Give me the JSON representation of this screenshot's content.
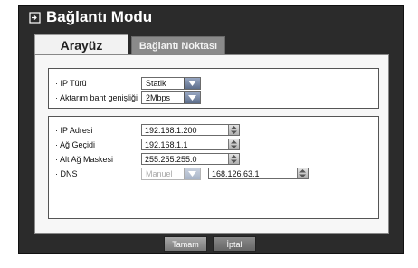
{
  "window": {
    "title": "Bağlantı Modu"
  },
  "tabs": [
    {
      "label": "Arayüz",
      "active": true
    },
    {
      "label": "Bağlantı Noktası",
      "active": false
    }
  ],
  "group1": {
    "ip_type": {
      "label": "· IP Türü",
      "value": "Statik"
    },
    "bandwidth": {
      "label": "· Aktarım bant genişliği",
      "value": "2Mbps"
    }
  },
  "group2": {
    "ip_address": {
      "label": "· IP Adresi",
      "value": "192.168.1.200"
    },
    "gateway": {
      "label": "· Ağ Geçidi",
      "value": "192.168.1.1"
    },
    "subnet": {
      "label": "· Alt Ağ Maskesi",
      "value": "255.255.255.0"
    },
    "dns": {
      "label": "· DNS",
      "mode": "Manuel",
      "value": "168.126.63.1"
    }
  },
  "footer": {
    "ok_label": "Tamam",
    "cancel_label": "İptal"
  },
  "colors": {
    "window_bg": "#2b2b2b",
    "tab_active": "#f2f2f2",
    "tab_inactive": "#8a8a8a",
    "select_arrow": "#6e7f9c"
  }
}
